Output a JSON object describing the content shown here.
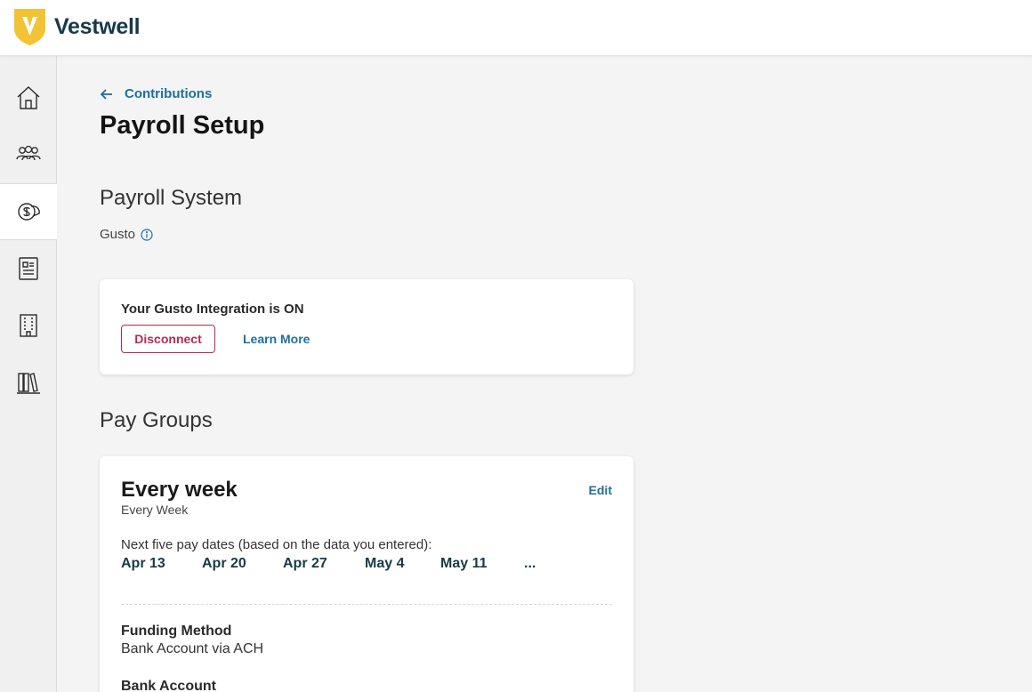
{
  "brand": {
    "name": "Vestwell",
    "logo_letter": "V",
    "accent": "#173a4a",
    "logo_color": "#f2c335"
  },
  "nav": [
    {
      "id": "home",
      "icon": "home-icon"
    },
    {
      "id": "people",
      "icon": "people-icon"
    },
    {
      "id": "contributions",
      "icon": "contributions-icon",
      "active": true
    },
    {
      "id": "documents",
      "icon": "documents-icon"
    },
    {
      "id": "company",
      "icon": "building-icon"
    },
    {
      "id": "resources",
      "icon": "library-icon"
    }
  ],
  "breadcrumb": {
    "label": "Contributions"
  },
  "page": {
    "title": "Payroll Setup"
  },
  "payroll_system": {
    "heading": "Payroll System",
    "name": "Gusto",
    "integration_status": "Your Gusto Integration is ON",
    "disconnect_label": "Disconnect",
    "learn_more_label": "Learn More"
  },
  "pay_groups": {
    "heading": "Pay Groups",
    "items": [
      {
        "name": "Every week",
        "frequency": "Every Week",
        "edit_label": "Edit",
        "next_dates_label": "Next five pay dates (based on the data you entered):",
        "dates": [
          "Apr 13",
          "Apr 20",
          "Apr 27",
          "May 4",
          "May 11",
          "..."
        ],
        "funding_method_label": "Funding Method",
        "funding_method_value": "Bank Account via ACH",
        "bank_account_label": "Bank Account"
      }
    ]
  },
  "colors": {
    "link": "#1e6fa0",
    "danger": "#b42b4f"
  }
}
